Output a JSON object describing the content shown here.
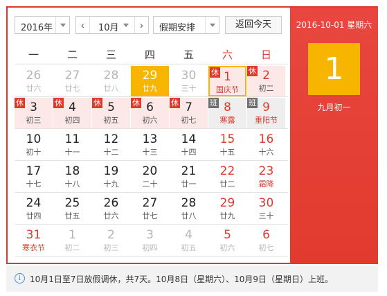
{
  "toolbar": {
    "year": "2016年",
    "month": "10月",
    "prev": "‹",
    "next": "›",
    "holiday": "假期安排",
    "today": "返回今天"
  },
  "weekdays": [
    "一",
    "二",
    "三",
    "四",
    "五",
    "六",
    "日"
  ],
  "weeks": [
    [
      {
        "d": "26",
        "l": "廿六",
        "other": true
      },
      {
        "d": "27",
        "l": "廿七",
        "other": true
      },
      {
        "d": "28",
        "l": "廿八",
        "other": true
      },
      {
        "d": "29",
        "l": "廿九",
        "other": true,
        "today": true
      },
      {
        "d": "30",
        "l": "三十",
        "other": true
      },
      {
        "d": "1",
        "l": "国庆节",
        "tag": "休",
        "festival": true,
        "selected": true
      },
      {
        "d": "2",
        "l": "初二",
        "tag": "休"
      }
    ],
    [
      {
        "d": "3",
        "l": "初三",
        "tag": "休"
      },
      {
        "d": "4",
        "l": "初四",
        "tag": "休"
      },
      {
        "d": "5",
        "l": "初五",
        "tag": "休"
      },
      {
        "d": "6",
        "l": "初六",
        "tag": "休"
      },
      {
        "d": "7",
        "l": "初七",
        "tag": "休"
      },
      {
        "d": "8",
        "l": "寒露",
        "tag": "班",
        "festival": true
      },
      {
        "d": "9",
        "l": "重阳节",
        "tag": "班",
        "festival": true
      }
    ],
    [
      {
        "d": "10",
        "l": "初十"
      },
      {
        "d": "11",
        "l": "十一"
      },
      {
        "d": "12",
        "l": "十二"
      },
      {
        "d": "13",
        "l": "十三"
      },
      {
        "d": "14",
        "l": "十四"
      },
      {
        "d": "15",
        "l": "十五"
      },
      {
        "d": "16",
        "l": "十六"
      }
    ],
    [
      {
        "d": "17",
        "l": "十七"
      },
      {
        "d": "18",
        "l": "十八"
      },
      {
        "d": "19",
        "l": "十九"
      },
      {
        "d": "20",
        "l": "二十"
      },
      {
        "d": "21",
        "l": "廿一"
      },
      {
        "d": "22",
        "l": "廿二"
      },
      {
        "d": "23",
        "l": "霜降",
        "festival": true
      }
    ],
    [
      {
        "d": "24",
        "l": "廿四"
      },
      {
        "d": "25",
        "l": "廿五"
      },
      {
        "d": "26",
        "l": "廿六"
      },
      {
        "d": "27",
        "l": "廿七"
      },
      {
        "d": "28",
        "l": "廿八"
      },
      {
        "d": "29",
        "l": "廿九"
      },
      {
        "d": "30",
        "l": "三十"
      }
    ],
    [
      {
        "d": "31",
        "l": "寒衣节",
        "festival": true
      },
      {
        "d": "1",
        "l": "初二",
        "other": true
      },
      {
        "d": "2",
        "l": "初三",
        "other": true
      },
      {
        "d": "3",
        "l": "初四",
        "other": true
      },
      {
        "d": "4",
        "l": "初五",
        "other": true
      },
      {
        "d": "5",
        "l": "初六",
        "other": true
      },
      {
        "d": "6",
        "l": "初七",
        "other": true
      }
    ]
  ],
  "side": {
    "date": "2016-10-01 星期六",
    "day": "1",
    "lunar": "九月初一"
  },
  "notice": {
    "icon": "i",
    "text": "10月1日至7日放假调休，共7天。10月8日（星期六）、10月9日（星期日）上班。"
  },
  "colors": {
    "accent": "#e0392c",
    "today": "#f7b500",
    "rest_bg": "#fde8e8",
    "work_tag": "#6e6e6e"
  }
}
